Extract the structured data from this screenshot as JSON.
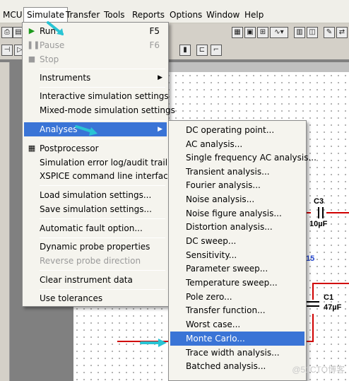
{
  "menubar": {
    "items": [
      "MCU",
      "Simulate",
      "Transfer",
      "Tools",
      "Reports",
      "Options",
      "Window",
      "Help"
    ]
  },
  "simulate_menu": {
    "run": "Run",
    "run_shortcut": "F5",
    "pause": "Pause",
    "pause_shortcut": "F6",
    "stop": "Stop",
    "instruments": "Instruments",
    "interactive_settings": "Interactive simulation settings",
    "mixed_mode_settings": "Mixed-mode simulation settings",
    "analyses": "Analyses",
    "postprocessor": "Postprocessor",
    "error_log": "Simulation error log/audit trail",
    "xspice": "XSPICE command line interface",
    "load_settings": "Load simulation settings...",
    "save_settings": "Save simulation settings...",
    "auto_fault": "Automatic fault option...",
    "dynamic_probe": "Dynamic probe properties",
    "reverse_probe": "Reverse probe direction",
    "clear_instrument": "Clear instrument data",
    "use_tolerances": "Use tolerances"
  },
  "analyses_menu": {
    "items": [
      "DC operating point...",
      "AC analysis...",
      "Single frequency AC analysis...",
      "Transient analysis...",
      "Fourier analysis...",
      "Noise analysis...",
      "Noise figure analysis...",
      "Distortion analysis...",
      "DC sweep...",
      "Sensitivity...",
      "Parameter sweep...",
      "Temperature sweep...",
      "Pole zero...",
      "Transfer function...",
      "Worst case...",
      "Monte Carlo...",
      "Trace width analysis...",
      "Batched analysis..."
    ]
  },
  "schematic": {
    "c3_label": "C3",
    "c3_value": "10µF",
    "c1_label": "C1",
    "c1_value": "47µF",
    "node_number": "15"
  },
  "watermark": "@51CTO博客",
  "colors": {
    "highlight": "#3a74d6",
    "wire": "#d00000",
    "cursor": "#29c4d4"
  }
}
